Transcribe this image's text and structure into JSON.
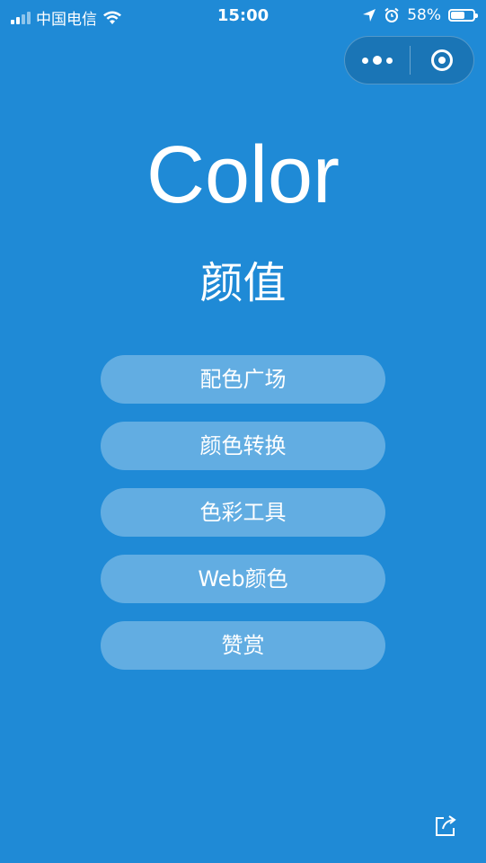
{
  "status_bar": {
    "carrier": "中国电信",
    "time": "15:00",
    "battery_percent": "58%",
    "battery_level": 0.58
  },
  "capsule": {
    "more_icon": "more-dots-icon",
    "close_icon": "target-close-icon"
  },
  "header": {
    "title_en": "Color",
    "title_zh": "颜值"
  },
  "menu": {
    "items": [
      {
        "label": "配色广场"
      },
      {
        "label": "颜色转换"
      },
      {
        "label": "色彩工具"
      },
      {
        "label": "Web颜色"
      },
      {
        "label": "赞赏"
      }
    ]
  },
  "colors": {
    "background": "#1F8AD6",
    "button_bg": "rgba(255,255,255,0.3)",
    "text": "#FFFFFF"
  },
  "share": {
    "icon": "share-icon"
  }
}
